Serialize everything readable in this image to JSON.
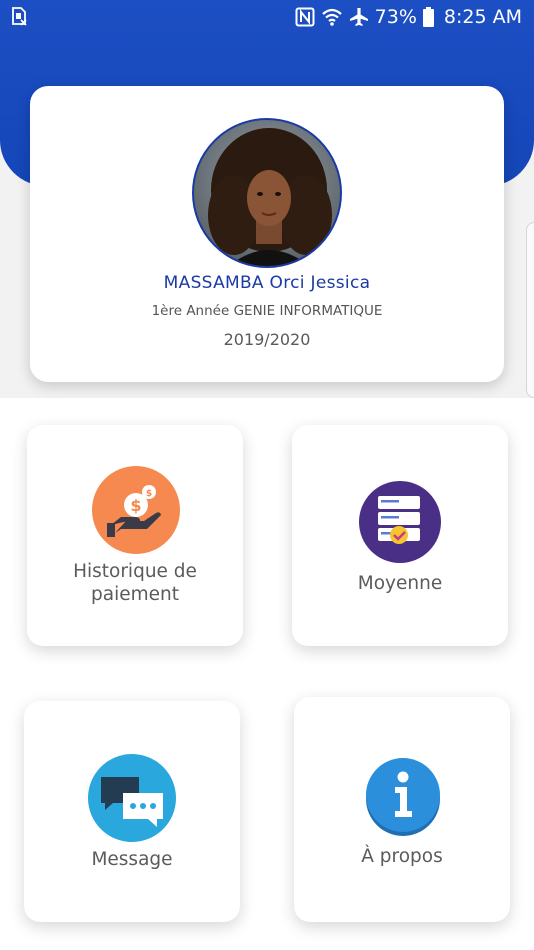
{
  "status_bar": {
    "time": "8:25 AM",
    "battery": "73%",
    "icons": [
      "sim-alert-icon",
      "nfc-icon",
      "wifi-icon",
      "airplane-icon",
      "battery-icon"
    ]
  },
  "profile": {
    "name": "MASSAMBA Orci Jessica",
    "program": "1ère Année GENIE INFORMATIQUE",
    "year": "2019/2020"
  },
  "menu": {
    "items": [
      {
        "label": "Historique de paiement",
        "icon": "money-hand-icon"
      },
      {
        "label": "Moyenne",
        "icon": "grades-list-icon"
      },
      {
        "label": "Message",
        "icon": "chat-bubbles-icon"
      },
      {
        "label": "À propos",
        "icon": "info-icon"
      }
    ]
  },
  "colors": {
    "header": "#1d4fc4",
    "name_text": "#1c3aa4",
    "payment_icon_bg": "#f6894f",
    "grades_icon_bg": "#4a2f86",
    "message_icon_bg": "#2aa7dd",
    "info_icon_bg": "#2b8fdc"
  }
}
